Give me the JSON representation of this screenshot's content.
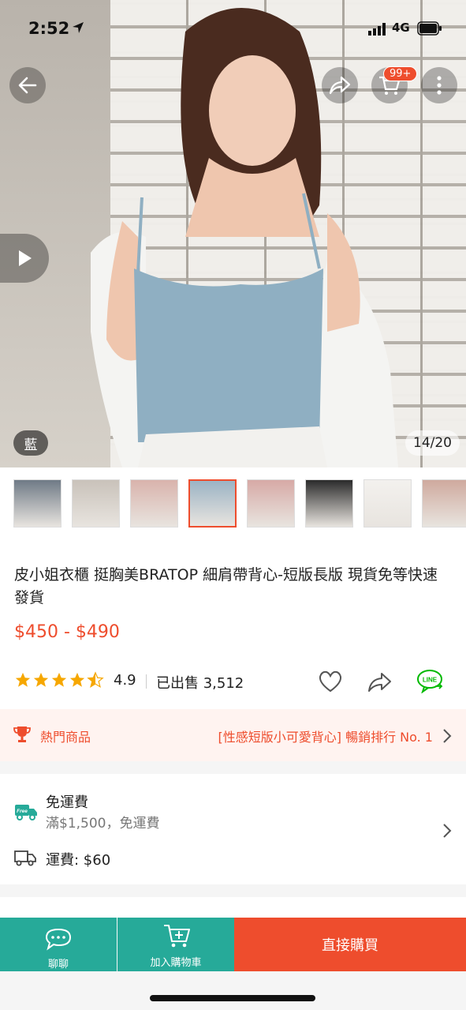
{
  "status_bar": {
    "time": "2:52",
    "network": "4G"
  },
  "header": {
    "cart_badge": "99+"
  },
  "gallery": {
    "variant_tag": "藍",
    "counter": "14/20",
    "thumbnails": [
      {
        "tone": "#6f7a86"
      },
      {
        "tone": "#c9c2ba"
      },
      {
        "tone": "#d9b3ac"
      },
      {
        "tone": "#9bb3c4",
        "active": true
      },
      {
        "tone": "#d7a9a6"
      },
      {
        "tone": "#2b2b2b"
      },
      {
        "tone": "#f3f1ee"
      },
      {
        "tone": "#cfa99e"
      }
    ]
  },
  "product": {
    "title": "皮小姐衣櫃 挺胸美BRATOP 細肩帶背心-短版長版 現貨免等快速發貨",
    "price": "$450 - $490",
    "rating": "4.9",
    "sold": "已出售 3,512",
    "rating_stars": 4.5
  },
  "hot_banner": {
    "label": "熱門商品",
    "rank_text": "[性感短版小可愛背心] 暢銷排行 No. 1"
  },
  "shipping": {
    "free_title": "免運費",
    "free_subtitle": "滿$1,500，免運費",
    "free_icon_text": "Free",
    "fee": "運費: $60"
  },
  "bottom_bar": {
    "chat_label": "聊聊",
    "cart_label": "加入購物車",
    "buy_label": "直接購買"
  },
  "actions": {
    "line_label": "LINE"
  },
  "colors": {
    "accent": "#ee4d2d",
    "teal": "#26aa99",
    "line_green": "#00b900"
  }
}
